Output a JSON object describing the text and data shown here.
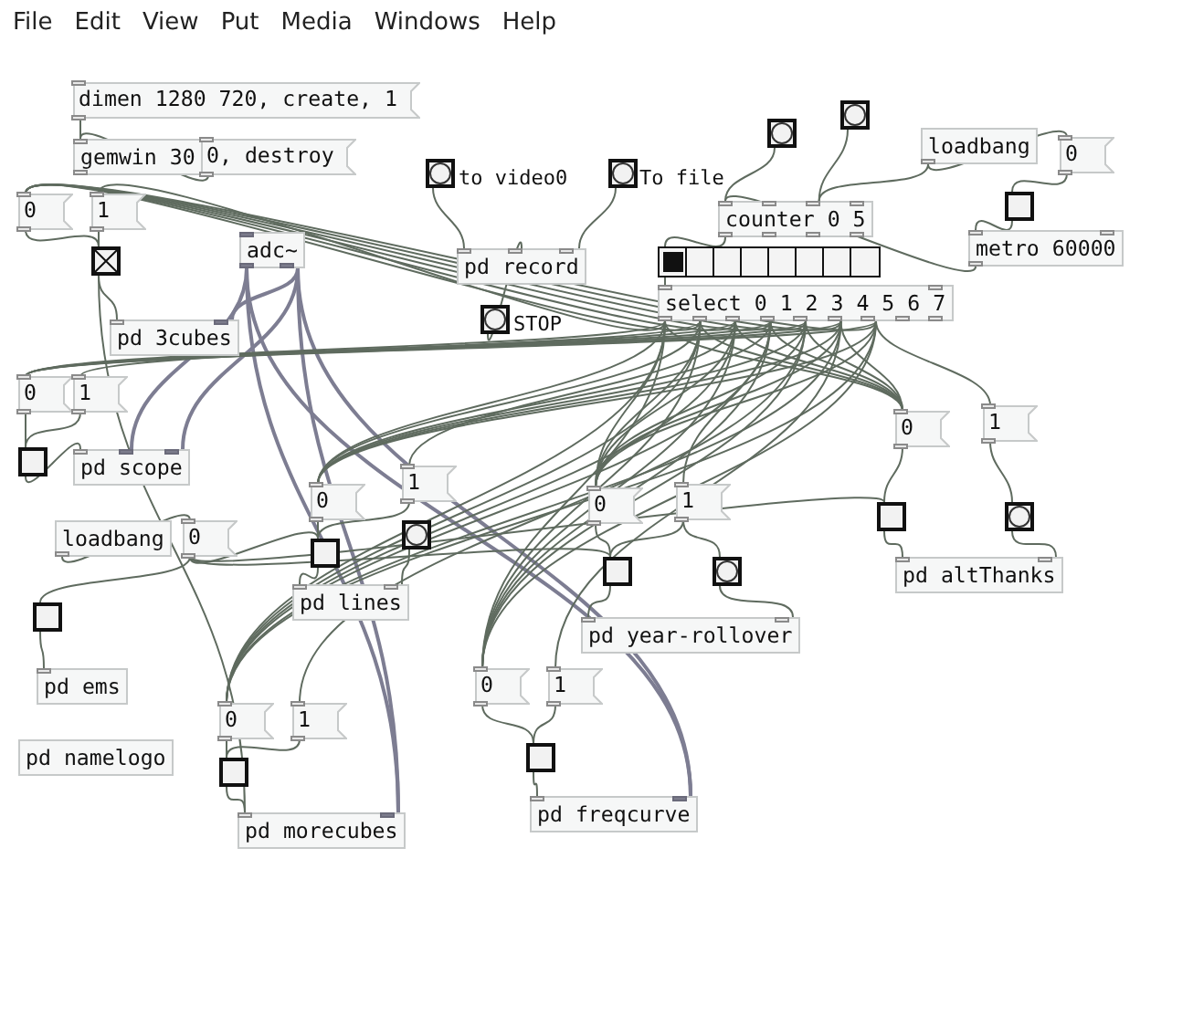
{
  "menu": [
    {
      "label": "File"
    },
    {
      "label": "Edit"
    },
    {
      "label": "View"
    },
    {
      "label": "Put"
    },
    {
      "label": "Media"
    },
    {
      "label": "Windows"
    },
    {
      "label": "Help"
    }
  ],
  "nodes": [
    {
      "kind": "message",
      "text": "dimen 1280 720, create, 1"
    },
    {
      "kind": "object",
      "text": "gemwin 30"
    },
    {
      "kind": "message",
      "text": "0, destroy"
    },
    {
      "kind": "message",
      "text": "0"
    },
    {
      "kind": "message",
      "text": "1"
    },
    {
      "kind": "toggle",
      "checked": true
    },
    {
      "kind": "object",
      "text": "adc~"
    },
    {
      "kind": "bang"
    },
    {
      "kind": "comment",
      "text": "to video0"
    },
    {
      "kind": "bang"
    },
    {
      "kind": "comment",
      "text": "To file"
    },
    {
      "kind": "object",
      "text": "pd record"
    },
    {
      "kind": "bang"
    },
    {
      "kind": "comment",
      "text": "STOP"
    },
    {
      "kind": "object",
      "text": "pd 3cubes"
    },
    {
      "kind": "message",
      "text": "0"
    },
    {
      "kind": "message",
      "text": "1"
    },
    {
      "kind": "toggle",
      "checked": false
    },
    {
      "kind": "object",
      "text": "pd scope"
    },
    {
      "kind": "bang"
    },
    {
      "kind": "bang"
    },
    {
      "kind": "object",
      "text": "loadbang"
    },
    {
      "kind": "message",
      "text": "0"
    },
    {
      "kind": "toggle",
      "checked": false
    },
    {
      "kind": "object",
      "text": "counter 0 5"
    },
    {
      "kind": "radio",
      "cells": [
        {
          "selected": true
        },
        {
          "selected": false
        },
        {
          "selected": false
        },
        {
          "selected": false
        },
        {
          "selected": false
        },
        {
          "selected": false
        },
        {
          "selected": false
        },
        {
          "selected": false
        }
      ]
    },
    {
      "kind": "object",
      "text": "select 0 1 2 3 4 5 6 7"
    },
    {
      "kind": "object",
      "text": "metro 60000"
    },
    {
      "kind": "message",
      "text": "0"
    },
    {
      "kind": "message",
      "text": "1"
    },
    {
      "kind": "object",
      "text": "loadbang"
    },
    {
      "kind": "message",
      "text": "0"
    },
    {
      "kind": "message",
      "text": "0"
    },
    {
      "kind": "message",
      "text": "1"
    },
    {
      "kind": "toggle",
      "checked": false
    },
    {
      "kind": "bang"
    },
    {
      "kind": "object",
      "text": "pd lines"
    },
    {
      "kind": "message",
      "text": "0"
    },
    {
      "kind": "message",
      "text": "1"
    },
    {
      "kind": "toggle",
      "checked": false
    },
    {
      "kind": "bang"
    },
    {
      "kind": "object",
      "text": "pd year-rollover"
    },
    {
      "kind": "toggle",
      "checked": false
    },
    {
      "kind": "bang"
    },
    {
      "kind": "object",
      "text": "pd altThanks"
    },
    {
      "kind": "toggle",
      "checked": false
    },
    {
      "kind": "object",
      "text": "pd ems"
    },
    {
      "kind": "object",
      "text": "pd namelogo"
    },
    {
      "kind": "message",
      "text": "0"
    },
    {
      "kind": "message",
      "text": "1"
    },
    {
      "kind": "toggle",
      "checked": false
    },
    {
      "kind": "object",
      "text": "pd morecubes"
    },
    {
      "kind": "message",
      "text": "0"
    },
    {
      "kind": "message",
      "text": "1"
    },
    {
      "kind": "toggle",
      "checked": false
    },
    {
      "kind": "object",
      "text": "pd freqcurve"
    }
  ]
}
